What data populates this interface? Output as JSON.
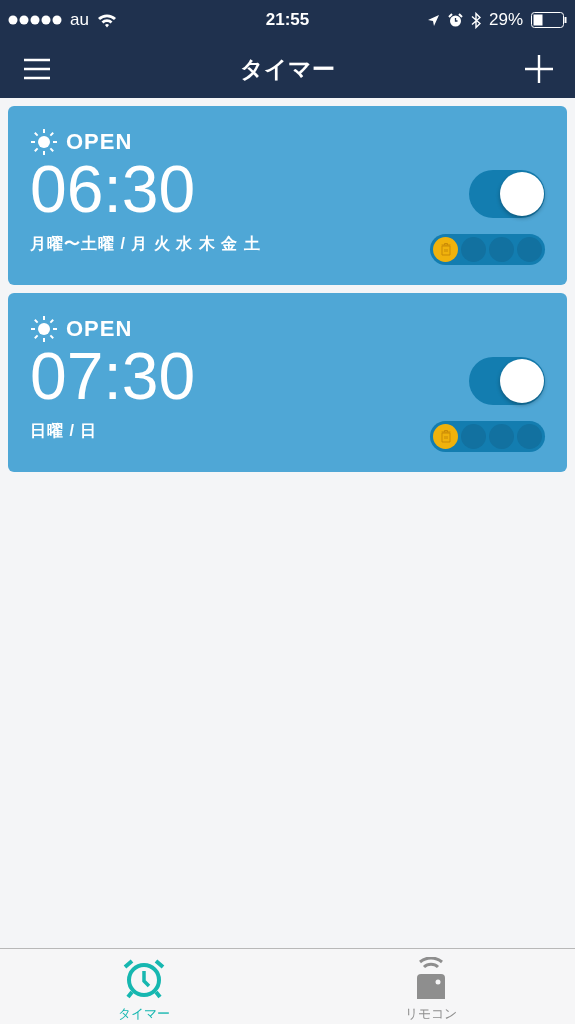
{
  "status_bar": {
    "carrier": "au",
    "time": "21:55",
    "battery": "29%"
  },
  "nav": {
    "title": "タイマー"
  },
  "timers": [
    {
      "label": "OPEN",
      "time": "06:30",
      "days": "月曜〜土曜 / 月 火 水 木 金 土",
      "on": true,
      "slots": [
        {
          "selected": true
        },
        {
          "selected": false
        },
        {
          "selected": false
        },
        {
          "selected": false
        }
      ]
    },
    {
      "label": "OPEN",
      "time": "07:30",
      "days": "日曜 / 日",
      "on": true,
      "slots": [
        {
          "selected": true
        },
        {
          "selected": false
        },
        {
          "selected": false
        },
        {
          "selected": false
        }
      ]
    }
  ],
  "tab_bar": [
    {
      "label": "タイマー",
      "kind": "timer",
      "selected": true
    },
    {
      "label": "リモコン",
      "kind": "remote",
      "selected": false
    }
  ]
}
